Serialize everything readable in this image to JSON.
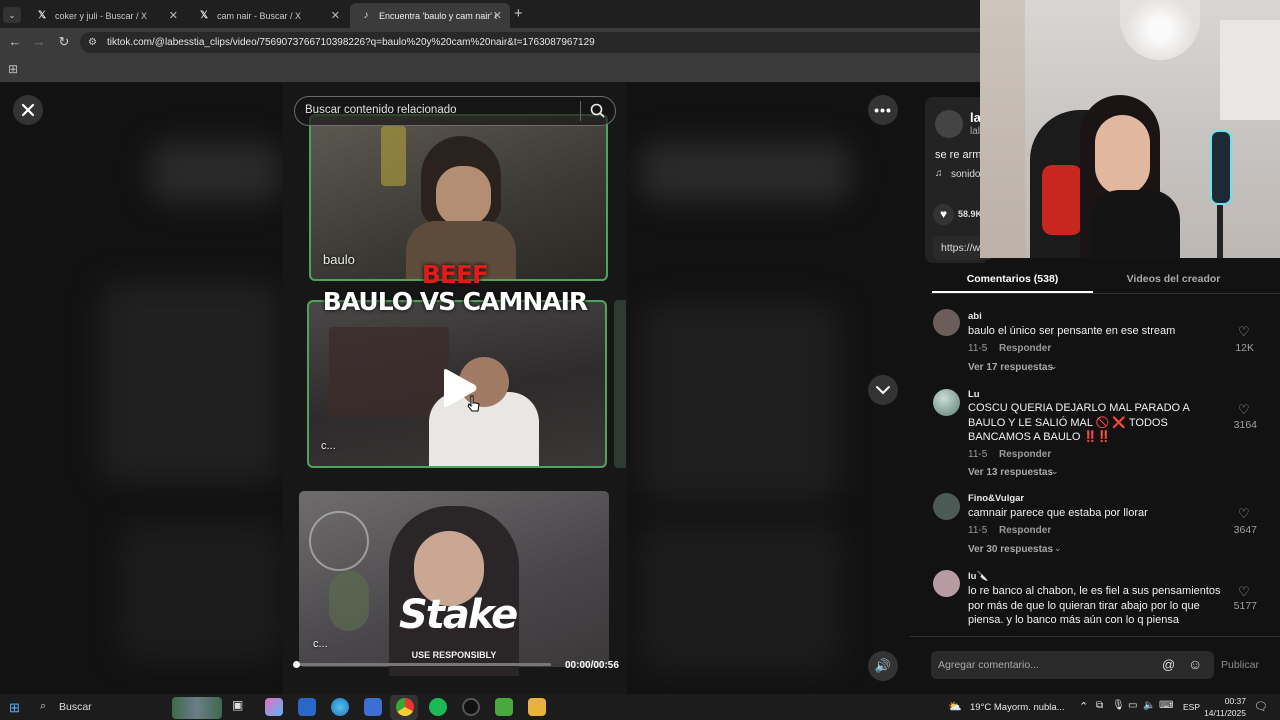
{
  "browser": {
    "tabs": [
      {
        "title": "coker y juli - Buscar / X",
        "icon": "x-logo",
        "active": false
      },
      {
        "title": "cam nair - Buscar / X",
        "icon": "x-logo",
        "active": false
      },
      {
        "title": "Encuentra 'baulo y cam nair' en",
        "icon": "tiktok-logo",
        "active": true
      }
    ],
    "new_tab": "+",
    "url": "tiktok.com/@labesstia_clips/video/7569073766710398226?q=baulo%20y%20cam%20nair&t=1763087967129"
  },
  "player": {
    "search_placeholder": "Buscar contenido relacionado",
    "panel1_label": "baulo",
    "title_line1": "BEEF",
    "title_line2": "BAULO VS CAMNAIR",
    "panel2_label": "c...",
    "panel3_label": "c...",
    "sponsor": "Stake",
    "sponsor_sub": "USE RESPONSIBLY",
    "time": "00:00/00:56",
    "progress": 0.0
  },
  "sidebar": {
    "author_initial": "la",
    "author_handle": "lal",
    "caption": "se re arm",
    "sound": "sonido",
    "likes": "58.9K",
    "link": "https://w",
    "tabs": [
      "Comentarios (538)",
      "Videos del creador"
    ]
  },
  "comments": [
    {
      "user": "abi",
      "text": "baulo el único ser pensante en ese stream",
      "date": "11-5",
      "reply": "Responder",
      "replies": "Ver 17 respuestas",
      "likes": "12K",
      "avatar_color": "#6b5d5a"
    },
    {
      "user": "Lu",
      "text": "COSCU QUERIA DEJARLO MAL PARADO A BAULO Y LE SALIÓ MAL 🚫 ❌ TODOS BANCAMOS A BAULO ‼️‼️",
      "date": "11-5",
      "reply": "Responder",
      "replies": "Ver 13 respuestas",
      "likes": "3164",
      "avatar_color": "#8fa6a0"
    },
    {
      "user": "Fino&Vulgar",
      "text": "camnair parece que estaba por llorar",
      "date": "11-5",
      "reply": "Responder",
      "replies": "Ver 30 respuestas",
      "likes": "3647",
      "avatar_color": "#4c5a55"
    },
    {
      "user": "lu🔪",
      "text": "lo re banco al chabon, le es fiel a sus pensamientos por más de que lo quieran tirar abajo por lo que piensa. y lo banco más aún con lo q piensa",
      "date": "11-5",
      "reply": "Responder",
      "replies": "",
      "likes": "5177",
      "avatar_color": "#b89aa2"
    }
  ],
  "comment_input": {
    "placeholder": "Agregar comentario...",
    "publish": "Publicar"
  },
  "taskbar": {
    "search": "Buscar",
    "weather": "19°C  Mayorm. nubla...",
    "lang": "ESP",
    "time": "00:37",
    "date": "14/11/2025"
  }
}
